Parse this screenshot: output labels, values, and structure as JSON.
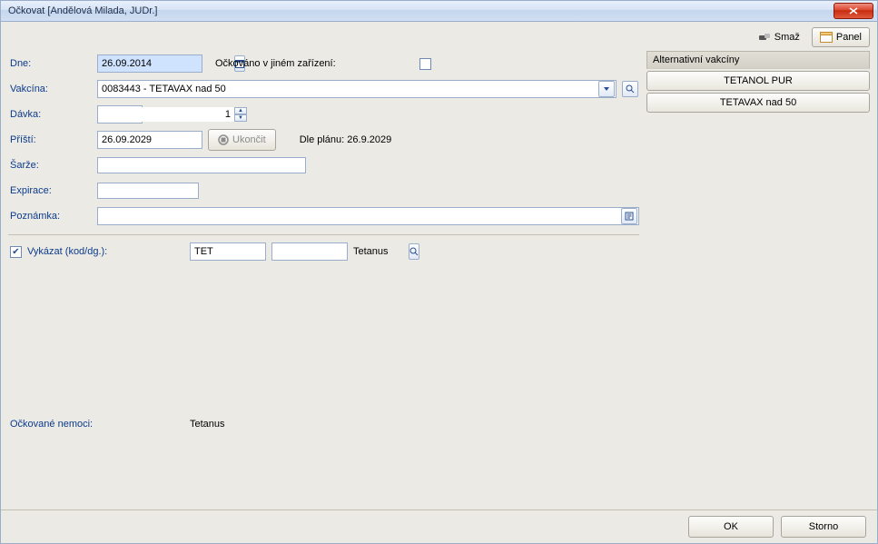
{
  "window": {
    "title": "Očkovat [Andělová Milada, JUDr.]"
  },
  "toolbar": {
    "smaz_label": "Smaž",
    "panel_label": "Panel"
  },
  "labels": {
    "dne": "Dne:",
    "ockovano_jinde": "Očkováno v jiném zařízení:",
    "vakcina": "Vakcína:",
    "davka": "Dávka:",
    "pristi": "Příští:",
    "ukoncit": "Ukončit",
    "dle_planu_prefix": "Dle plánu: ",
    "sarze": "Šarže:",
    "expirace": "Expirace:",
    "poznamka": "Poznámka:",
    "vykazat": "Vykázat (kod/dg.):",
    "ockovane_nemoci": "Očkované nemoci:"
  },
  "values": {
    "dne": "26.09.2014",
    "ockovano_jinde_checked": false,
    "vakcina": "0083443 - TETAVAX nad 50",
    "davka": "1",
    "pristi": "26.09.2029",
    "dle_planu": "26.9.2029",
    "sarze": "",
    "expirace": "",
    "poznamka": "",
    "vykazat_checked": true,
    "vykazat_kod": "TET",
    "vykazat_dg": "",
    "vykazat_text": "Tetanus",
    "ockovane_nemoci": "Tetanus"
  },
  "side": {
    "header": "Alternativní vakcíny",
    "items": [
      "TETANOL PUR",
      "TETAVAX nad 50"
    ]
  },
  "footer": {
    "ok": "OK",
    "storno": "Storno"
  }
}
